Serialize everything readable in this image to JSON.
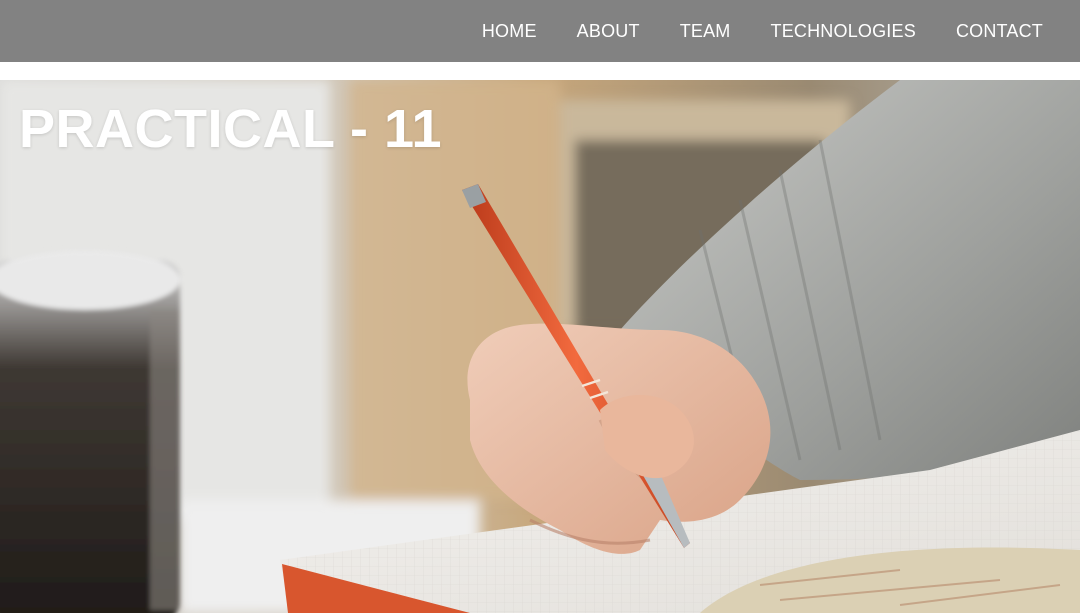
{
  "nav": {
    "links": [
      {
        "label": "HOME"
      },
      {
        "label": "ABOUT"
      },
      {
        "label": "TEAM"
      },
      {
        "label": "TECHNOLOGIES"
      },
      {
        "label": "CONTACT"
      }
    ]
  },
  "hero": {
    "title": "PRACTICAL - 11",
    "image": "hand-writing-with-orange-pen-in-notebook"
  },
  "colors": {
    "navbar": "#828282",
    "nav_text": "#ffffff",
    "title_text": "#ffffff",
    "pen": "#e0512e"
  }
}
